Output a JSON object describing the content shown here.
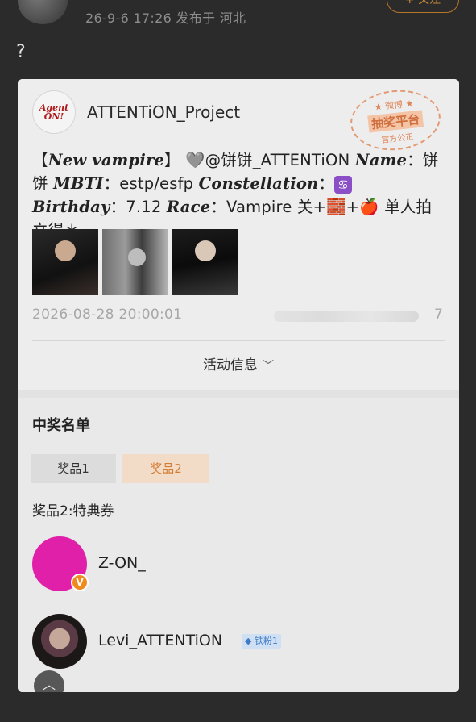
{
  "header": {
    "meta": "26-9-6 17:26  发布于 河北",
    "follow_label": "+ 关注"
  },
  "post_body": "?",
  "card": {
    "org_logo_text": "Agent ON!",
    "org_name": "ATTENTiON_Project",
    "stamp": {
      "top": "★ 微博 ★",
      "middle": "抽奖平台",
      "bottom": "官方公正"
    },
    "text": {
      "bracket_open": "【",
      "new_vampire": "New vampire",
      "bracket_close": "】 ",
      "heart": "🩶",
      "mention": "@饼饼_ATTENTiON ",
      "name_label": "Name",
      "name_value": "：饼饼 ",
      "mbti_label": "MBTI",
      "mbti_value": "：estp/esfp ",
      "const_label": "Constellation",
      "const_sep": "：",
      "cancer": "♋",
      "birth_label": " Birthday",
      "birth_value": "：7.12 ",
      "race_label": "Race",
      "race_value": "：Vampire 关+",
      "brick": "🧱",
      "plus": "+",
      "apple": "🍎",
      "tail": " 单人拍立得＊…"
    },
    "time": "2026-08-28 20:00:01",
    "blur_tail": "7",
    "activity_label": "活动信息",
    "activity_icon": "chevron-down-icon"
  },
  "winners": {
    "title": "中奖名单",
    "tabs": [
      {
        "label": "奖品1",
        "active": false
      },
      {
        "label": "奖品2",
        "active": true
      }
    ],
    "prize_label": "奖品2:特典券",
    "list": [
      {
        "name": "Z-ON_",
        "badge": "V",
        "fan_badge": ""
      },
      {
        "name": "Levi_ATTENTiON",
        "badge": "",
        "fan_badge": "◆ 铁粉1"
      }
    ]
  },
  "colors": {
    "background": "#2b2b2b",
    "card": "#ececec",
    "accent": "#d47b32",
    "avatar_pink": "#e020a8"
  }
}
